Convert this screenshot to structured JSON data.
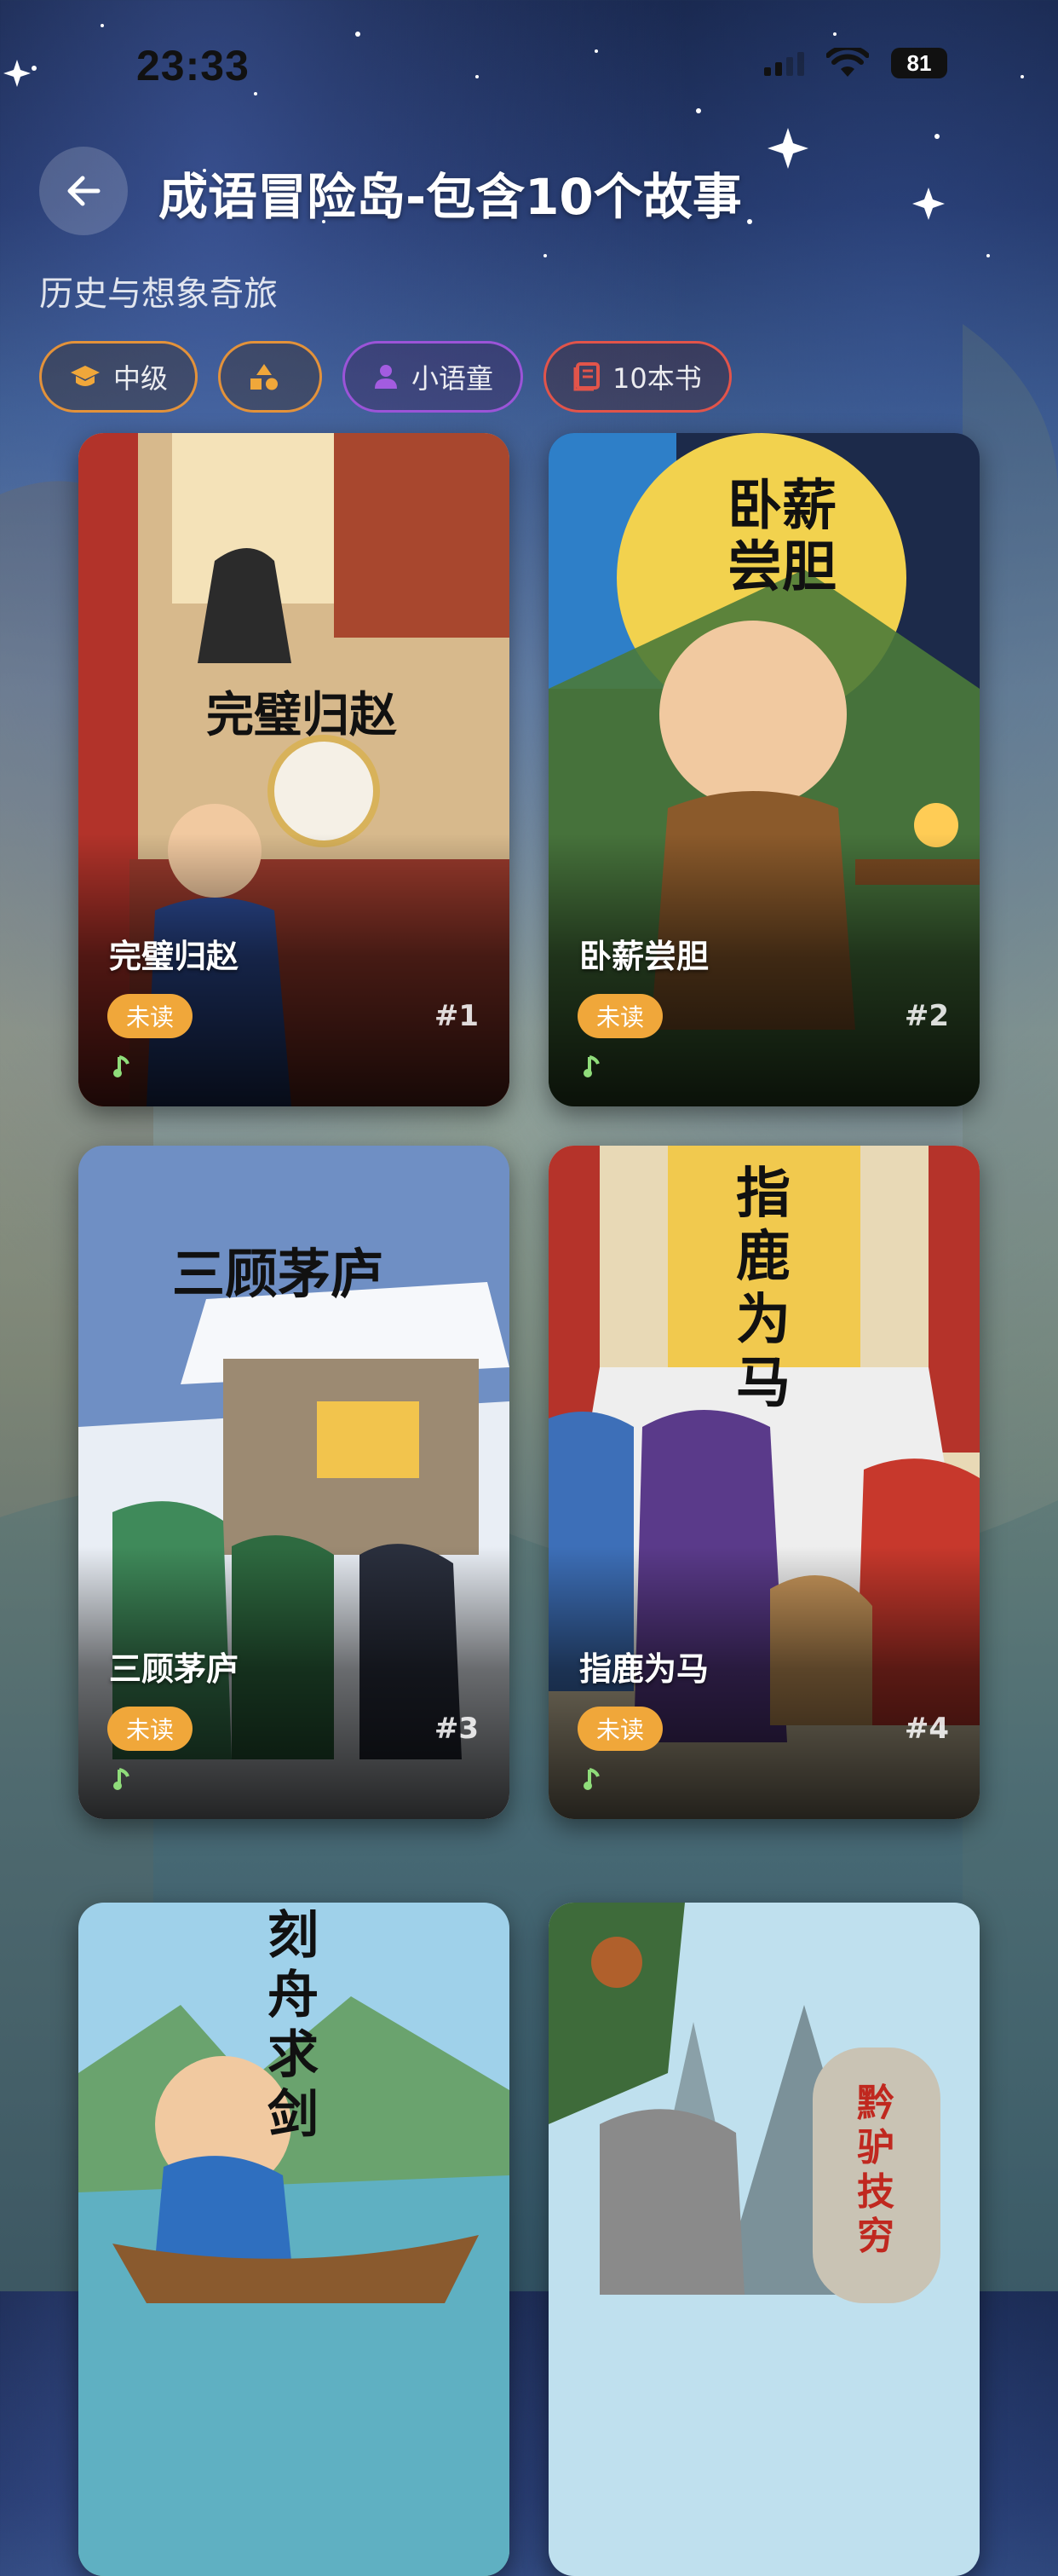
{
  "status_bar": {
    "time": "23:33",
    "battery": "81"
  },
  "header": {
    "title": "成语冒险岛-包含10个故事",
    "subtitle": "历史与想象奇旅"
  },
  "chips": [
    {
      "icon": "graduation-cap-icon",
      "label": "中级",
      "color": "#e3923a"
    },
    {
      "icon": "shapes-icon",
      "label": "",
      "color": "#e3923a"
    },
    {
      "icon": "person-icon",
      "label": "小语童",
      "color": "#9b54d8"
    },
    {
      "icon": "book-icon",
      "label": "10本书",
      "color": "#e2544a"
    }
  ],
  "stories": [
    {
      "title": "完璧归赵",
      "cover_caption": "完璧归赵",
      "status": "未读",
      "number": "#1"
    },
    {
      "title": "卧薪尝胆",
      "cover_caption": "卧薪尝胆",
      "status": "未读",
      "number": "#2"
    },
    {
      "title": "三顾茅庐",
      "cover_caption": "三顾茅庐",
      "status": "未读",
      "number": "#3"
    },
    {
      "title": "指鹿为马",
      "cover_caption": "指鹿为马",
      "status": "未读",
      "number": "#4"
    },
    {
      "title": "",
      "cover_caption": "刻舟求剑",
      "status": "",
      "number": ""
    },
    {
      "title": "",
      "cover_caption": "黔驴技穷",
      "status": "",
      "number": ""
    }
  ]
}
